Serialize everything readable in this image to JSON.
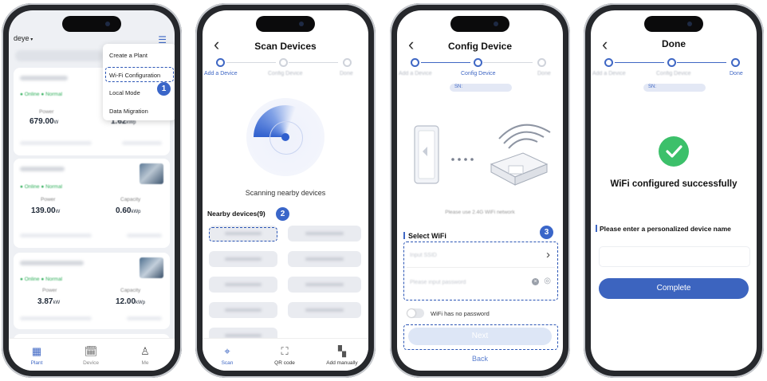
{
  "phone1": {
    "user_name": "deye",
    "menu": {
      "items": [
        "Create a Plant",
        "Wi-Fi Configuration",
        "Local Mode",
        "Data Migration"
      ]
    },
    "badge": "1",
    "cards": [
      {
        "power_label": "Power",
        "power_value": "679.00",
        "power_unit": "W",
        "capacity_value": "1.62",
        "capacity_unit": "kWp",
        "online": "Online",
        "normal": "Normal"
      },
      {
        "power_label": "Power",
        "power_value": "139.00",
        "power_unit": "W",
        "capacity_label": "Capacity",
        "capacity_value": "0.60",
        "capacity_unit": "kWp",
        "online": "Online",
        "normal": "Normal"
      },
      {
        "power_label": "Power",
        "power_value": "3.87",
        "power_unit": "kW",
        "capacity_label": "Capacity",
        "capacity_value": "12.00",
        "capacity_unit": "kWp",
        "online": "Online",
        "normal": "Normal"
      }
    ],
    "tabs": [
      "Plant",
      "Device",
      "Me"
    ]
  },
  "phone2": {
    "title": "Scan Devices",
    "steps": [
      "Add a Device",
      "Config Device",
      "Done"
    ],
    "scanning_text": "Scanning nearby devices",
    "nearby_label": "Nearby devices(9)",
    "badge": "2",
    "tabs": [
      "Scan",
      "QR code",
      "Add manually"
    ]
  },
  "phone3": {
    "title": "Config Device",
    "steps": [
      "Add a Device",
      "Config Device",
      "Done"
    ],
    "sn_label": "SN:",
    "hint": "Please use 2.4G WiFi network",
    "select_wifi": "Select WiFi",
    "wifi_placeholder": "Input SSID",
    "password_placeholder": "Please input password",
    "no_password": "WiFi has no password",
    "next": "Next",
    "back": "Back",
    "badge": "3"
  },
  "phone4": {
    "title": "Done",
    "steps": [
      "Add a Device",
      "Config Device",
      "Done"
    ],
    "sn_label": "SN:",
    "success_text": "WiFi configured successfully",
    "name_label": "Please enter a personalized device name",
    "complete": "Complete"
  },
  "colors": {
    "accent": "#3c64bf",
    "success": "#3cc06a",
    "online": "#2fae5a"
  }
}
